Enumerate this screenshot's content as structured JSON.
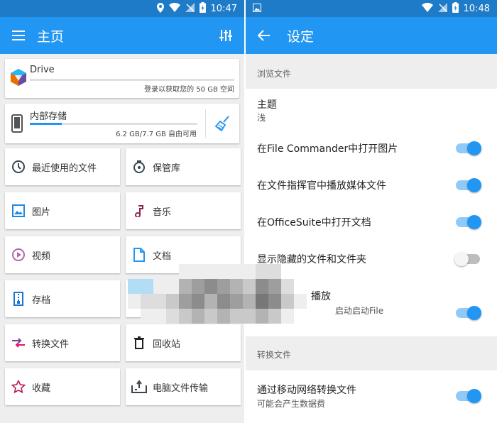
{
  "status": {
    "time_left": "10:47",
    "time_right": "10:48"
  },
  "left": {
    "title": "主页",
    "drive": {
      "label": "Drive",
      "sub": "登录以获取您的 50 GB 空间",
      "progress": 0
    },
    "storage": {
      "label": "内部存储",
      "sub": "6.2 GB/7.7 GB 自由可用",
      "progress": 0.19
    },
    "tiles": [
      {
        "label": "最近使用的文件",
        "icon": "clock-icon"
      },
      {
        "label": "保管库",
        "icon": "vault-icon"
      },
      {
        "label": "图片",
        "icon": "image-icon"
      },
      {
        "label": "音乐",
        "icon": "music-icon"
      },
      {
        "label": "视频",
        "icon": "video-icon"
      },
      {
        "label": "文档",
        "icon": "document-icon"
      },
      {
        "label": "存档",
        "icon": "archive-icon"
      },
      {
        "label": "",
        "icon": ""
      },
      {
        "label": "转换文件",
        "icon": "convert-icon"
      },
      {
        "label": "回收站",
        "icon": "trash-icon"
      },
      {
        "label": "收藏",
        "icon": "star-icon"
      },
      {
        "label": "电脑文件传输",
        "icon": "pc-transfer-icon"
      }
    ]
  },
  "right": {
    "title": "设定",
    "section1": "浏览文件",
    "theme_title": "主题",
    "theme_value": "浅",
    "rows": [
      {
        "title": "在File Commander中打开图片",
        "on": true
      },
      {
        "title": "在文件指挥官中播放媒体文件",
        "on": true
      },
      {
        "title": "在OfficeSuite中打开文档",
        "on": true
      },
      {
        "title": "显示隐藏的文件和文件夹",
        "on": false
      },
      {
        "title": "播放",
        "sub": "启动启动File",
        "on": true
      }
    ],
    "section2": "转换文件",
    "convert_row": {
      "title": "通过移动网络转换文件",
      "sub": "可能会产生数据费",
      "on": true
    }
  },
  "colors": {
    "primary": "#2196f3",
    "status": "#1e7bc8",
    "switch_track_on": "#90caf9"
  }
}
